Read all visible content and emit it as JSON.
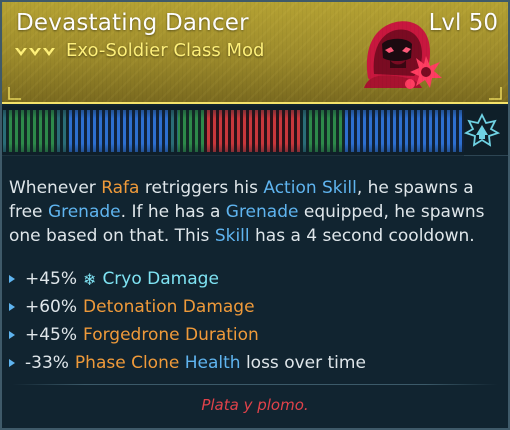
{
  "item": {
    "name": "Devastating Dancer",
    "level": "Lvl 50",
    "type": "Exo-Soldier Class Mod",
    "rarity_icon": "triple-chevron-rarity-icon",
    "class_icon": "hooded-exo-soldier-icon",
    "manufacturer_icon": "manufacturer-emblem-icon"
  },
  "description": {
    "parts": [
      {
        "text": "Whenever ",
        "style": "plain"
      },
      {
        "text": "Rafa",
        "style": "orange"
      },
      {
        "text": " retriggers his ",
        "style": "plain"
      },
      {
        "text": "Action Skill",
        "style": "blue"
      },
      {
        "text": ", he spawns a free ",
        "style": "plain"
      },
      {
        "text": "Grenade",
        "style": "blue"
      },
      {
        "text": ". If he has a ",
        "style": "plain"
      },
      {
        "text": "Grenade",
        "style": "blue"
      },
      {
        "text": " equipped, he spawns one based on that. This ",
        "style": "plain"
      },
      {
        "text": "Skill",
        "style": "blue"
      },
      {
        "text": " has a 4 second cooldown.",
        "style": "plain"
      }
    ]
  },
  "stats": [
    {
      "value": "+45%",
      "icon": "snowflake-icon",
      "label": "Cryo Damage",
      "label_color": "cyan"
    },
    {
      "value": "+60%",
      "label": "Detonation Damage",
      "label_color": "orange"
    },
    {
      "value": "+45%",
      "label": "Forgedrone Duration",
      "label_color": "orange"
    },
    {
      "value": "-33%",
      "label_a": "Phase Clone",
      "label_b": "Health",
      "label_c": "loss over time"
    }
  ],
  "flavor": "Plata y plomo.",
  "colors": {
    "rarity_gold": "#b5a233",
    "title_text": "#ffffff",
    "type_text": "#fff17a",
    "keyword_orange": "#ef9a3a",
    "keyword_blue": "#5fb4ef",
    "cryo": "#7fe3f3",
    "flavor_red": "#e0424a",
    "background": "#112430"
  }
}
